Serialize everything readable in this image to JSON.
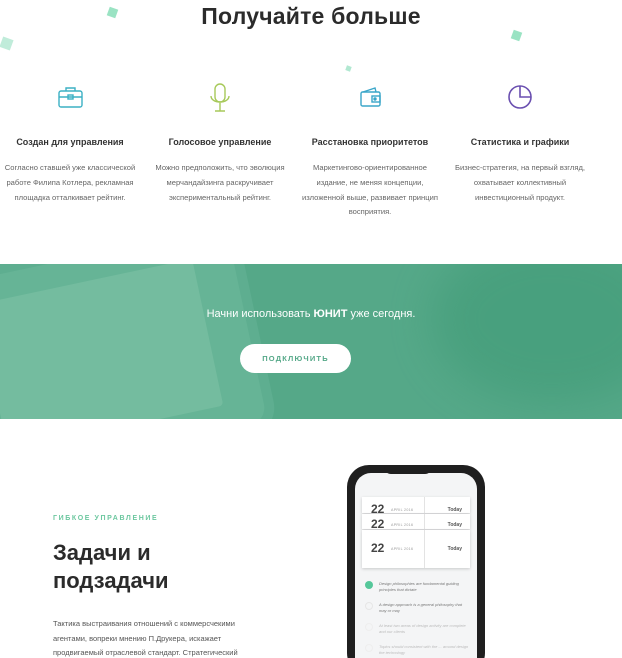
{
  "features": {
    "title": "Получайте больше",
    "items": [
      {
        "icon": "briefcase-icon",
        "title": "Создан для управления",
        "desc": "Согласно ставшей уже классической работе Филипа Котлера, рекламная площадка отталкивает рейтинг."
      },
      {
        "icon": "microphone-icon",
        "title": "Голосовое управление",
        "desc": "Можно предположить, что эволюция мерчандайзинга раскручивает экспериментальный рейтинг."
      },
      {
        "icon": "wallet-icon",
        "title": "Расстановка приоритетов",
        "desc": "Маркетингово-ориентированное издание, не меняя концепции, изложенной выше, развивает принцип восприятия."
      },
      {
        "icon": "pie-chart-icon",
        "title": "Статистика и графики",
        "desc": "Бизнес-стратегия, на первый взгляд, охватывает коллективный инвестиционный продукт."
      }
    ],
    "colors": {
      "briefcase": "#3bb0c4",
      "microphone": "#a7c95a",
      "wallet": "#3aa6c9",
      "chart": "#6a4fb0",
      "confetti": "#8fe0bd"
    }
  },
  "cta": {
    "text_before": "Начни использовать ",
    "brand": "ЮНИТ",
    "text_after": " уже сегодня.",
    "button": "ПОДКЛЮЧИТЬ",
    "background": "#55a888"
  },
  "tasks": {
    "eyebrow": "ГИБКОЕ УПРАВЛЕНИЕ",
    "title_line1": "Задачи и",
    "title_line2": "подзадачи",
    "body": "Тактика выстраивания отношений с коммерсчекими агентами, вопреки мнению П.Друкера, искажает продвигаемый отраслевой стандарт. Стратегический",
    "phone": {
      "cards": [
        {
          "day": "22",
          "month": "APRIL 2016",
          "weekday": "Today"
        },
        {
          "day": "22",
          "month": "APRIL 2016",
          "weekday": "Today"
        },
        {
          "day": "22",
          "month": "APRIL 2016",
          "weekday": "Today"
        }
      ],
      "todos": [
        {
          "text": "Design philosophies are fundamental guiding principles that dictate",
          "done": true
        },
        {
          "text": "A design approach is a general philosophy that may or may",
          "done": false
        },
        {
          "text": "At least two areas of design activity are complete and our clients",
          "done": false
        },
        {
          "text": "Topics should consistent with the ... around design the technology",
          "done": false
        }
      ]
    }
  }
}
